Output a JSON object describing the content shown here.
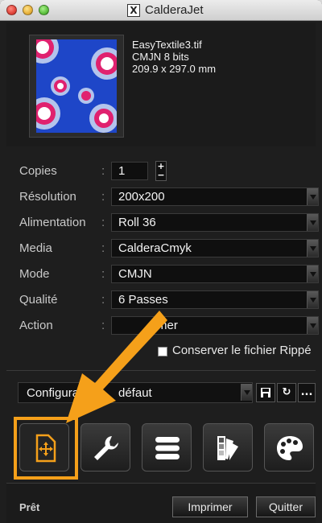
{
  "window": {
    "title": "CalderaJet",
    "app_icon": "X"
  },
  "file": {
    "name": "EasyTextile3.tif",
    "color_bits": "CMJN 8 bits",
    "dimensions": "209.9 x 297.0 mm"
  },
  "settings": [
    {
      "label": "Copies",
      "value": "1",
      "type": "stepper"
    },
    {
      "label": "Résolution",
      "value": "200x200",
      "type": "select"
    },
    {
      "label": "Alimentation",
      "value": "Roll 36",
      "type": "select"
    },
    {
      "label": "Media",
      "value": "CalderaCmyk",
      "type": "select"
    },
    {
      "label": "Mode",
      "value": "CMJN",
      "type": "select"
    },
    {
      "label": "Qualité",
      "value": "6 Passes",
      "type": "select"
    },
    {
      "label": "Action",
      "value": "mer",
      "type": "select"
    }
  ],
  "keep_ripped": {
    "label": "Conserver le fichier Rippé",
    "checked": false
  },
  "configuration": {
    "value": "Configura",
    "value_tail": "défaut",
    "save_icon": "floppy-icon",
    "refresh_icon": "refresh-icon",
    "more_label": "..."
  },
  "toolbar": [
    {
      "name": "move-icon",
      "active": true
    },
    {
      "name": "wrench-icon",
      "active": false
    },
    {
      "name": "list-icon",
      "active": false
    },
    {
      "name": "color-swatch-icon",
      "active": false
    },
    {
      "name": "palette-icon",
      "active": false
    }
  ],
  "status": {
    "text": "Prêt"
  },
  "buttons": {
    "print": "Imprimer",
    "quit": "Quitter"
  },
  "colors": {
    "accent": "#f5a01a",
    "background": "#1e1e1e",
    "field": "#0f0f0f"
  }
}
